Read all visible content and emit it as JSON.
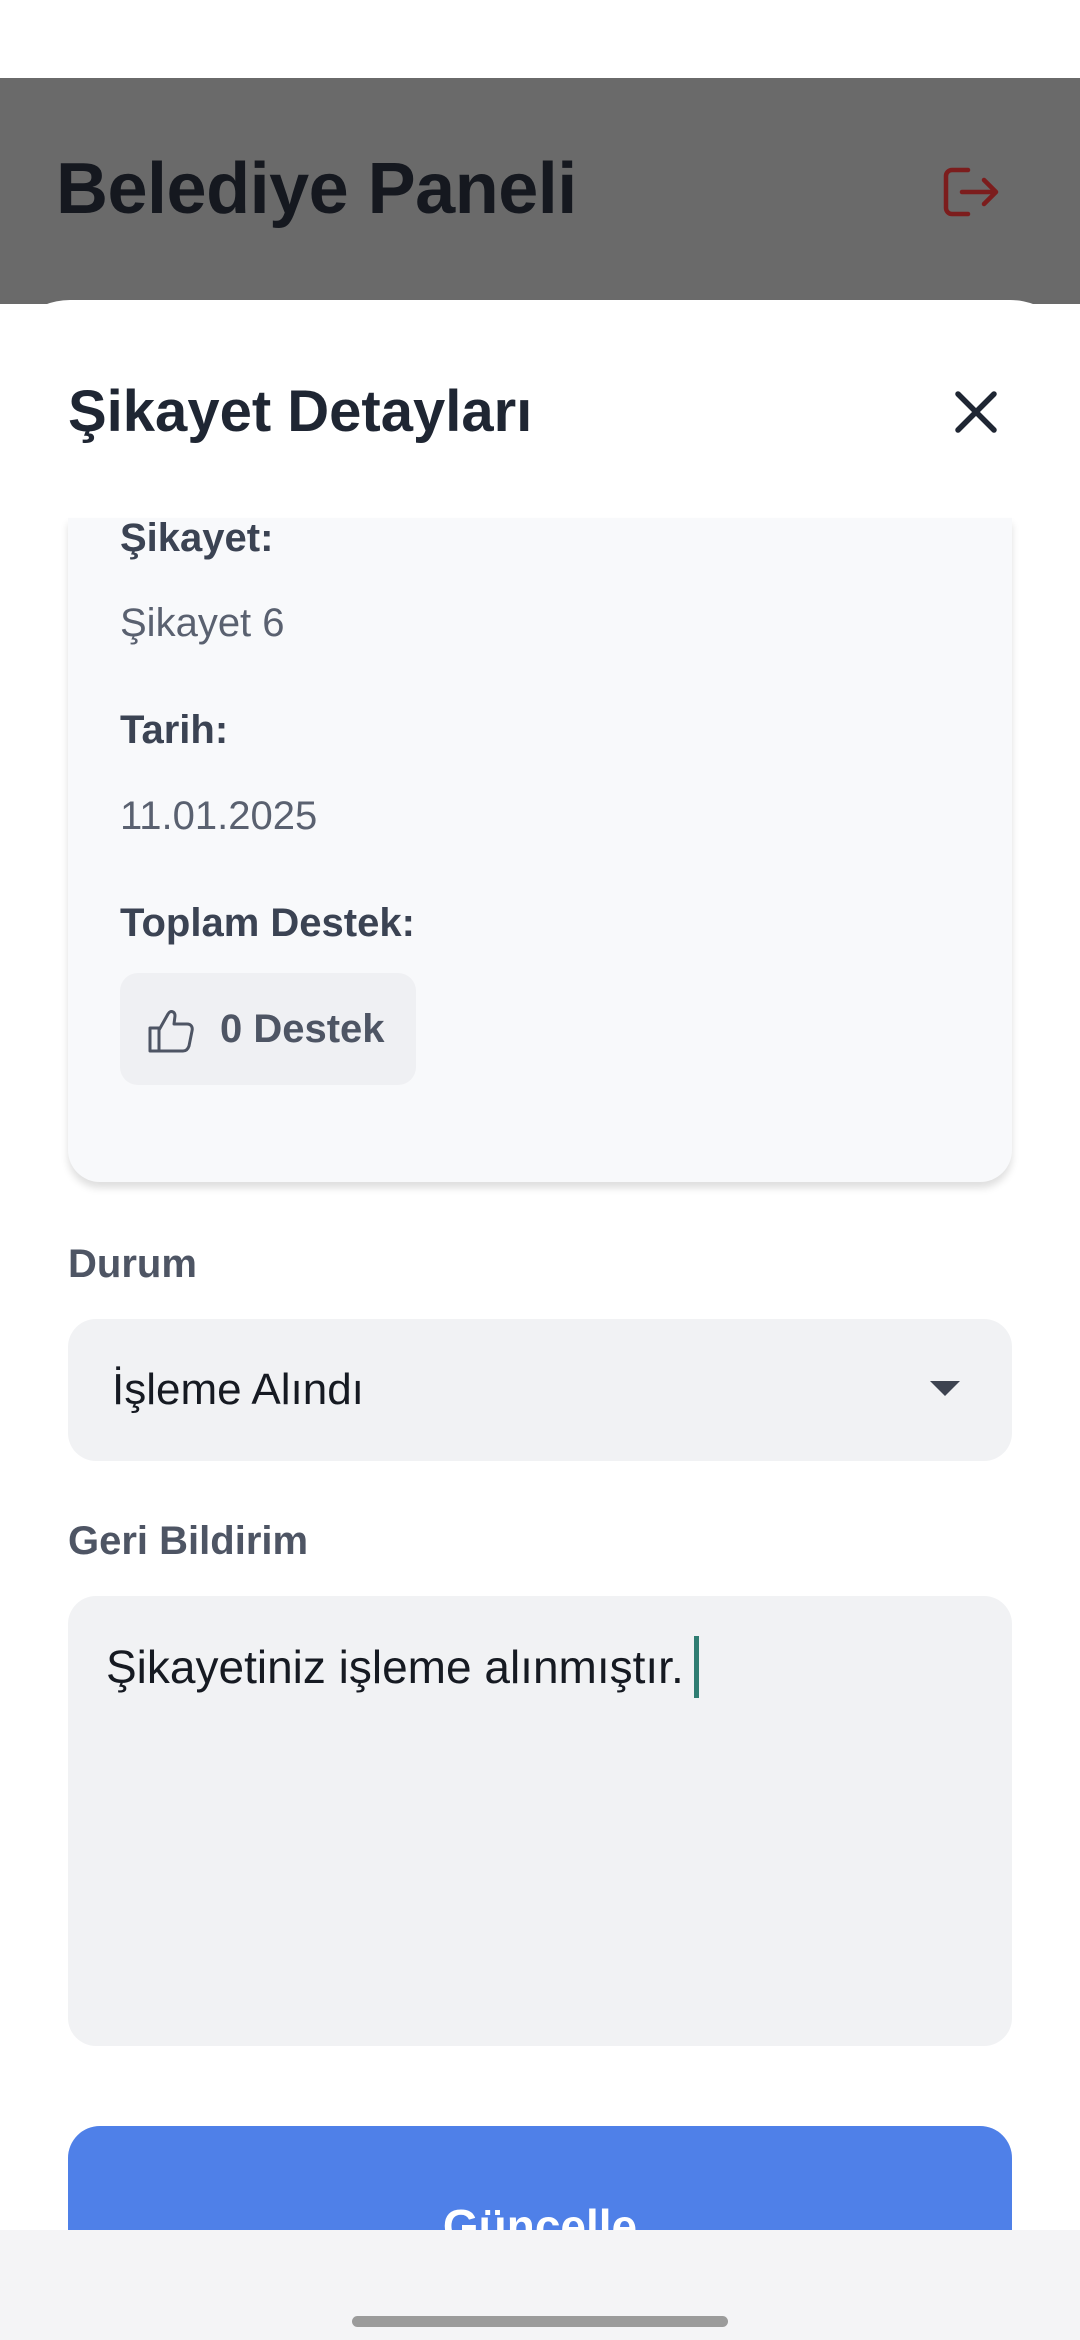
{
  "header": {
    "title": "Belediye Paneli",
    "logout_icon": "logout-icon"
  },
  "sheet": {
    "title": "Şikayet Detayları",
    "close_icon": "close-icon",
    "details": {
      "complaint_label": "Şikayet:",
      "complaint_value": "Şikayet 6",
      "date_label": "Tarih:",
      "date_value": "11.01.2025",
      "support_label": "Toplam Destek:",
      "support_value": "0 Destek",
      "support_icon": "thumbs-up-icon"
    },
    "status_label": "Durum",
    "status_selected": "İşleme Alındı",
    "feedback_label": "Geri Bildirim",
    "feedback_value": "Şikayetiniz işleme alınmıştır.",
    "update_button": "Güncelle"
  },
  "colors": {
    "primary": "#4f80e8",
    "logout_icon": "#7c1d1d",
    "overlay_header": "#6a6a6a",
    "cursor": "#2f7d72"
  }
}
